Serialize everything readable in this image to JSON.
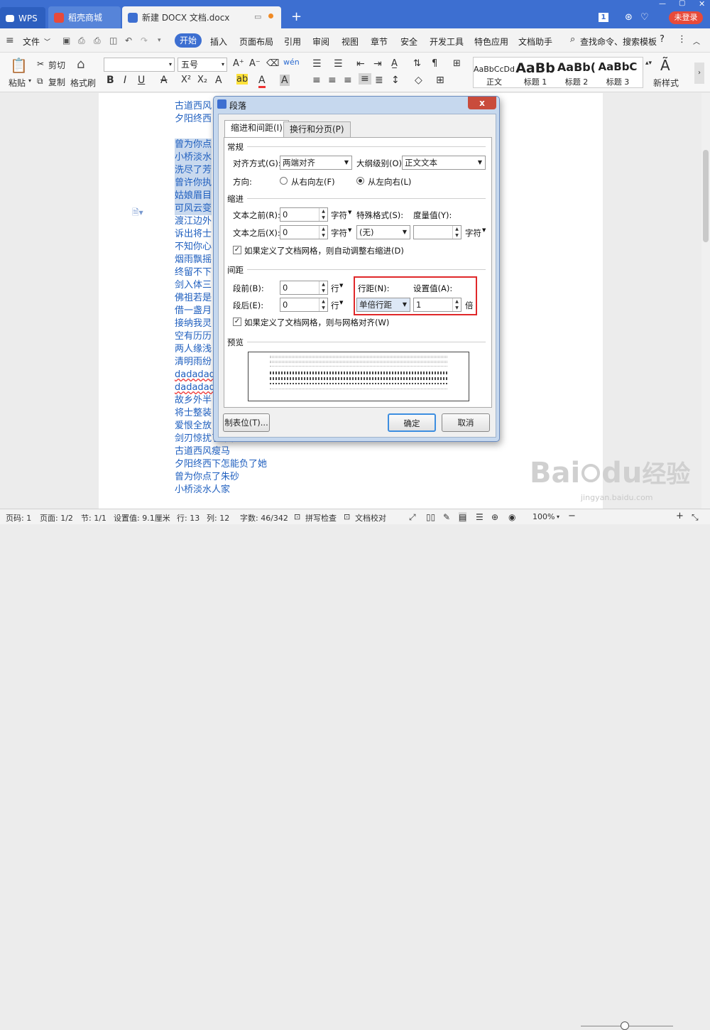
{
  "titlebar": {
    "tabs": [
      {
        "label": "WPS"
      },
      {
        "label": "稻壳商城"
      },
      {
        "label": "新建 DOCX 文档.docx"
      }
    ],
    "page_badge": "1",
    "login_label": "未登录"
  },
  "menu": {
    "file_label": "文件",
    "items": [
      "开始",
      "插入",
      "页面布局",
      "引用",
      "审阅",
      "视图",
      "章节",
      "安全",
      "开发工具",
      "特色应用",
      "文档助手"
    ],
    "search_label": "查找命令、搜索模板"
  },
  "ribbon": {
    "paste_label": "粘贴",
    "cut_label": "剪切",
    "copy_label": "复制",
    "format_painter_label": "格式刷",
    "font_name": "",
    "font_size": "五号",
    "styles": [
      {
        "preview": "AaBbCcDd",
        "label": "正文"
      },
      {
        "preview": "AaBb",
        "label": "标题 1"
      },
      {
        "preview": "AaBb(",
        "label": "标题 2"
      },
      {
        "preview": "AaBbC",
        "label": "标题 3"
      }
    ],
    "new_style_label": "新样式"
  },
  "document": {
    "lines": [
      {
        "text": "古道西风",
        "selected": false
      },
      {
        "text": "夕阳终西",
        "selected": false
      },
      {
        "text": "曾为你点",
        "selected": true
      },
      {
        "text": "小桥淡水",
        "selected": true
      },
      {
        "text": "洗尽了芳",
        "selected": true
      },
      {
        "text": "曾许你执",
        "selected": true
      },
      {
        "text": "姑娘眉目",
        "selected": true
      },
      {
        "text": "可风云变",
        "selected": true
      },
      {
        "text": "渡江边外",
        "selected": false
      },
      {
        "text": "诉出将士",
        "selected": false
      },
      {
        "text": "不知你心",
        "selected": false
      },
      {
        "text": "烟雨飘摇",
        "selected": false
      },
      {
        "text": "终留不下",
        "selected": false
      },
      {
        "text": "剑入体三",
        "selected": false
      },
      {
        "text": "佛祖若是",
        "selected": false
      },
      {
        "text": "借一盏月",
        "selected": false
      },
      {
        "text": "接纳我灵",
        "selected": false
      },
      {
        "text": "空有历历",
        "selected": false
      },
      {
        "text": "两人缘浅",
        "selected": false
      },
      {
        "text": "清明雨纷",
        "selected": false
      },
      {
        "text": "dadadad",
        "selected": false
      },
      {
        "text": "dadadad",
        "selected": false
      },
      {
        "text": "故乡外半",
        "selected": false
      },
      {
        "text": "将士整装",
        "selected": false
      },
      {
        "text": "爱恨全放",
        "selected": false
      },
      {
        "text": "剑刃惊扰了梨花",
        "selected": false
      },
      {
        "text": "古道西风瘦马",
        "selected": false
      },
      {
        "text": "夕阳终西下怎能负了她",
        "selected": false
      },
      {
        "text": "曾为你点了朱砂",
        "selected": false
      },
      {
        "text": "小桥淡水人家",
        "selected": false
      }
    ]
  },
  "dialog": {
    "title": "段落",
    "close_label": "x",
    "tabs": [
      "缩进和间距(I)",
      "换行和分页(P)"
    ],
    "general": {
      "section": "常规",
      "align_label": "对齐方式(G):",
      "align_value": "两端对齐",
      "outline_label": "大纲级别(O):",
      "outline_value": "正文文本",
      "direction_label": "方向:",
      "rtl_label": "从右向左(F)",
      "ltr_label": "从左向右(L)"
    },
    "indent": {
      "section": "缩进",
      "before_label": "文本之前(R):",
      "before_value": "0",
      "before_unit": "字符",
      "after_label": "文本之后(X):",
      "after_value": "0",
      "after_unit": "字符",
      "special_label": "特殊格式(S):",
      "special_value": "(无)",
      "measure_label": "度量值(Y):",
      "measure_value": "",
      "measure_unit": "字符",
      "grid_check": "如果定义了文档网格，则自动调整右缩进(D)"
    },
    "spacing": {
      "section": "间距",
      "before_label": "段前(B):",
      "before_value": "0",
      "before_unit": "行",
      "after_label": "段后(E):",
      "after_value": "0",
      "after_unit": "行",
      "line_label": "行距(N):",
      "line_value": "单倍行距",
      "set_label": "设置值(A):",
      "set_value": "1",
      "set_unit": "倍",
      "grid_check": "如果定义了文档网格，则与网格对齐(W)"
    },
    "preview": {
      "section": "预览"
    },
    "tabs_button": "制表位(T)...",
    "ok_button": "确定",
    "cancel_button": "取消"
  },
  "status": {
    "page": "页码: 1",
    "pages": "页面: 1/2",
    "section": "节: 1/1",
    "setting": "设置值: 9.1厘米",
    "row": "行: 13",
    "col": "列: 12",
    "words": "字数: 46/342",
    "spell": "拼写检查",
    "proof": "文档校对",
    "zoom": "100%"
  },
  "watermark": {
    "brand": "Bai",
    "brand2": "du",
    "jingyan": "经验",
    "url": "jingyan.baidu.com"
  },
  "colors": {
    "titlebar": "#3d6fd1",
    "accent_red": "#e0282a",
    "selection": "#c9d9ee"
  }
}
